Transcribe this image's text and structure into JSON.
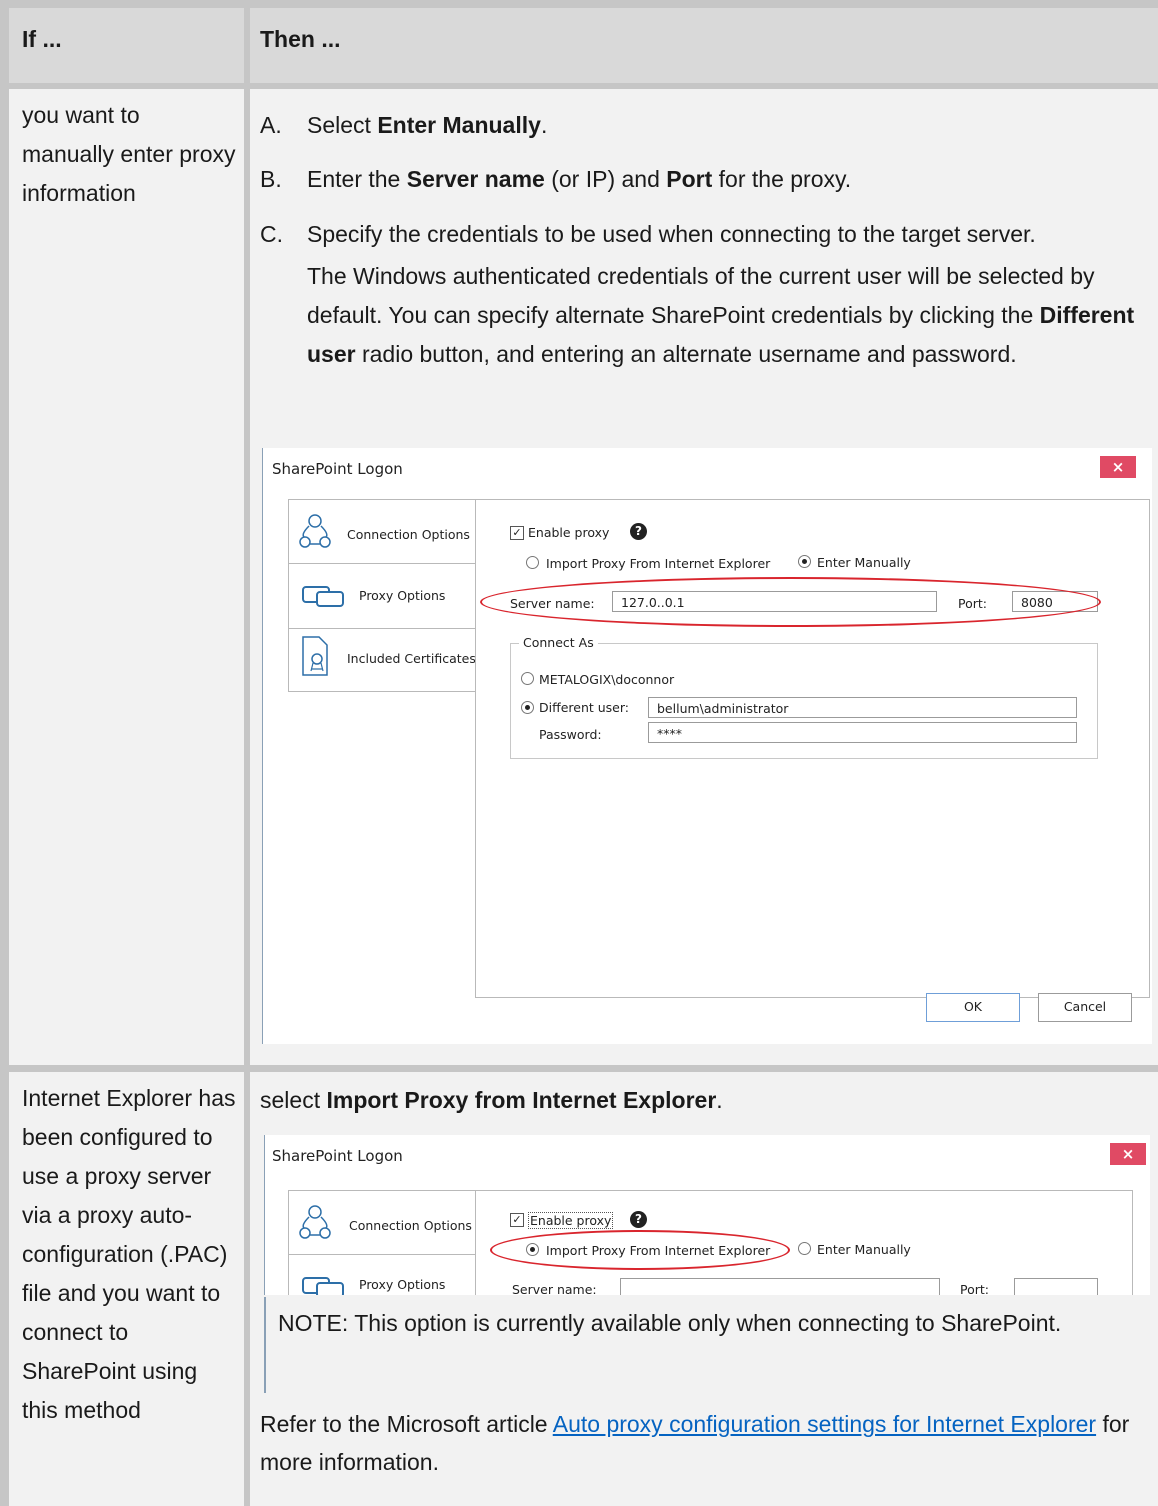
{
  "table": {
    "header": {
      "if_label": "If ...",
      "then_label": "Then ..."
    },
    "row1": {
      "if_text": "you want to manually enter proxy information",
      "steps": [
        {
          "letter": "A.",
          "pre": "Select ",
          "bold": "Enter Manually",
          "post": "."
        },
        {
          "letter": "B.",
          "pre": "Enter the ",
          "bold": "Server name",
          "mid": " (or IP) and ",
          "bold2": "Port",
          "post": " for the proxy."
        },
        {
          "letter": "C.",
          "text": "Specify the credentials to be used when connecting to the target server."
        }
      ],
      "para_pre": "The Windows authenticated credentials of the current user will be selected by default. You can specify alternate SharePoint credentials by clicking the ",
      "para_bold": "Different user",
      "para_post": " radio button, and entering an alternate username and password."
    },
    "row2": {
      "if_text": "Internet Explorer has been configured to use a proxy server via a proxy auto-configuration (.PAC) file and you want  to connect to SharePoint using this method",
      "then_pre": "select ",
      "then_bold": "Import Proxy from Internet Explorer",
      "then_post": ".",
      "note": "NOTE:  This option is currently available only when connecting to SharePoint.",
      "refer_pre": "Refer to the Microsoft article ",
      "refer_link": "Auto proxy configuration settings for Internet Explorer",
      "refer_post": " for more information."
    }
  },
  "dialog1": {
    "title": "SharePoint Logon",
    "close": "×",
    "tabs": [
      "Connection Options",
      "Proxy Options",
      "Included Certificates"
    ],
    "enable_proxy": "Enable proxy",
    "help": "?",
    "radio_import": "Import Proxy From Internet Explorer",
    "radio_manual": "Enter Manually",
    "server_label": "Server name:",
    "server_value": "127.0..0.1",
    "port_label": "Port:",
    "port_value": "8080",
    "connect_as": "Connect As",
    "current_user": "METALOGIX\\doconnor",
    "different_user": "Different user:",
    "different_user_value": "bellum\\administrator",
    "password_label": "Password:",
    "password_value": "****",
    "ok": "OK",
    "cancel": "Cancel"
  },
  "dialog2": {
    "title": "SharePoint Logon",
    "close": "×",
    "tabs": [
      "Connection Options",
      "Proxy Options"
    ],
    "enable_proxy": "Enable proxy",
    "help": "?",
    "radio_import": "Import Proxy From Internet Explorer",
    "radio_manual": "Enter Manually",
    "server_label": "Server name:",
    "port_label": "Port:"
  },
  "colors": {
    "accent_red": "#d9252d",
    "link": "#0563c1",
    "header_bg": "#d9d9d9"
  }
}
